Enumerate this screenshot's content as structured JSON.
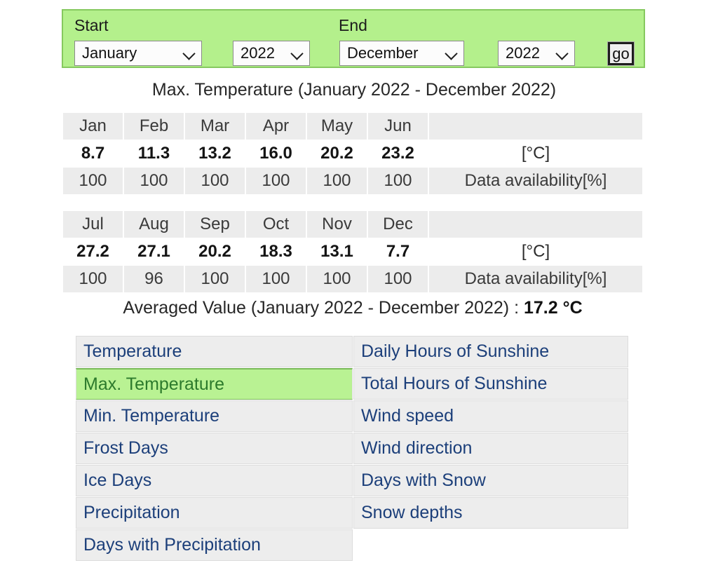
{
  "picker": {
    "start_label": "Start",
    "end_label": "End",
    "start_month": "January",
    "start_year": "2022",
    "end_month": "December",
    "end_year": "2022",
    "go_label": "go",
    "panel_color": "#b4f08c",
    "panel_border_color": "#86c95f"
  },
  "data_title": "Max. Temperature (January 2022 - December 2022)",
  "chart_data": {
    "type": "table",
    "title": "Max. Temperature (January 2022 - December 2022)",
    "categories": [
      "Jan",
      "Feb",
      "Mar",
      "Apr",
      "May",
      "Jun",
      "Jul",
      "Aug",
      "Sep",
      "Oct",
      "Nov",
      "Dec"
    ],
    "series": [
      {
        "name": "Max. Temperature",
        "unit": "[°C]",
        "values": [
          8.7,
          11.3,
          13.2,
          16.0,
          20.2,
          23.2,
          27.2,
          27.1,
          20.2,
          18.3,
          13.1,
          7.7
        ]
      },
      {
        "name": "Data availability[%]",
        "unit": "[%]",
        "values": [
          100,
          100,
          100,
          100,
          100,
          100,
          100,
          96,
          100,
          100,
          100,
          100
        ]
      }
    ],
    "xlabel": "",
    "ylabel": "[°C]",
    "average": 17.2,
    "average_unit": "°C"
  },
  "table1": {
    "months": [
      "Jan",
      "Feb",
      "Mar",
      "Apr",
      "May",
      "Jun"
    ],
    "values": [
      "8.7",
      "11.3",
      "13.2",
      "16.0",
      "20.2",
      "23.2"
    ],
    "availability": [
      "100",
      "100",
      "100",
      "100",
      "100",
      "100"
    ],
    "unit_label": "[°C]",
    "availability_label": "Data availability[%]"
  },
  "table2": {
    "months": [
      "Jul",
      "Aug",
      "Sep",
      "Oct",
      "Nov",
      "Dec"
    ],
    "values": [
      "27.2",
      "27.1",
      "20.2",
      "18.3",
      "13.1",
      "7.7"
    ],
    "availability": [
      "100",
      "96",
      "100",
      "100",
      "100",
      "100"
    ],
    "unit_label": "[°C]",
    "availability_label": "Data availability[%]",
    "average_prefix": "Averaged Value (January 2022 - December 2022) : ",
    "average_value": "17.2 °C"
  },
  "parameters": {
    "left": [
      {
        "label": "Temperature",
        "active": false
      },
      {
        "label": "Max. Temperature",
        "active": true
      },
      {
        "label": "Min. Temperature",
        "active": false
      },
      {
        "label": "Frost Days",
        "active": false
      },
      {
        "label": "Ice Days",
        "active": false
      },
      {
        "label": "Precipitation",
        "active": false
      },
      {
        "label": "Days with Precipitation",
        "active": false
      }
    ],
    "right": [
      {
        "label": "Daily Hours of Sunshine",
        "active": false
      },
      {
        "label": "Total Hours of Sunshine",
        "active": false
      },
      {
        "label": "Wind speed",
        "active": false
      },
      {
        "label": "Wind direction",
        "active": false
      },
      {
        "label": "Days with Snow",
        "active": false
      },
      {
        "label": "Snow depths",
        "active": false
      }
    ],
    "link_color": "#1c3f7a",
    "active_bg": "#b9f293",
    "active_color": "#2c7a2c"
  }
}
